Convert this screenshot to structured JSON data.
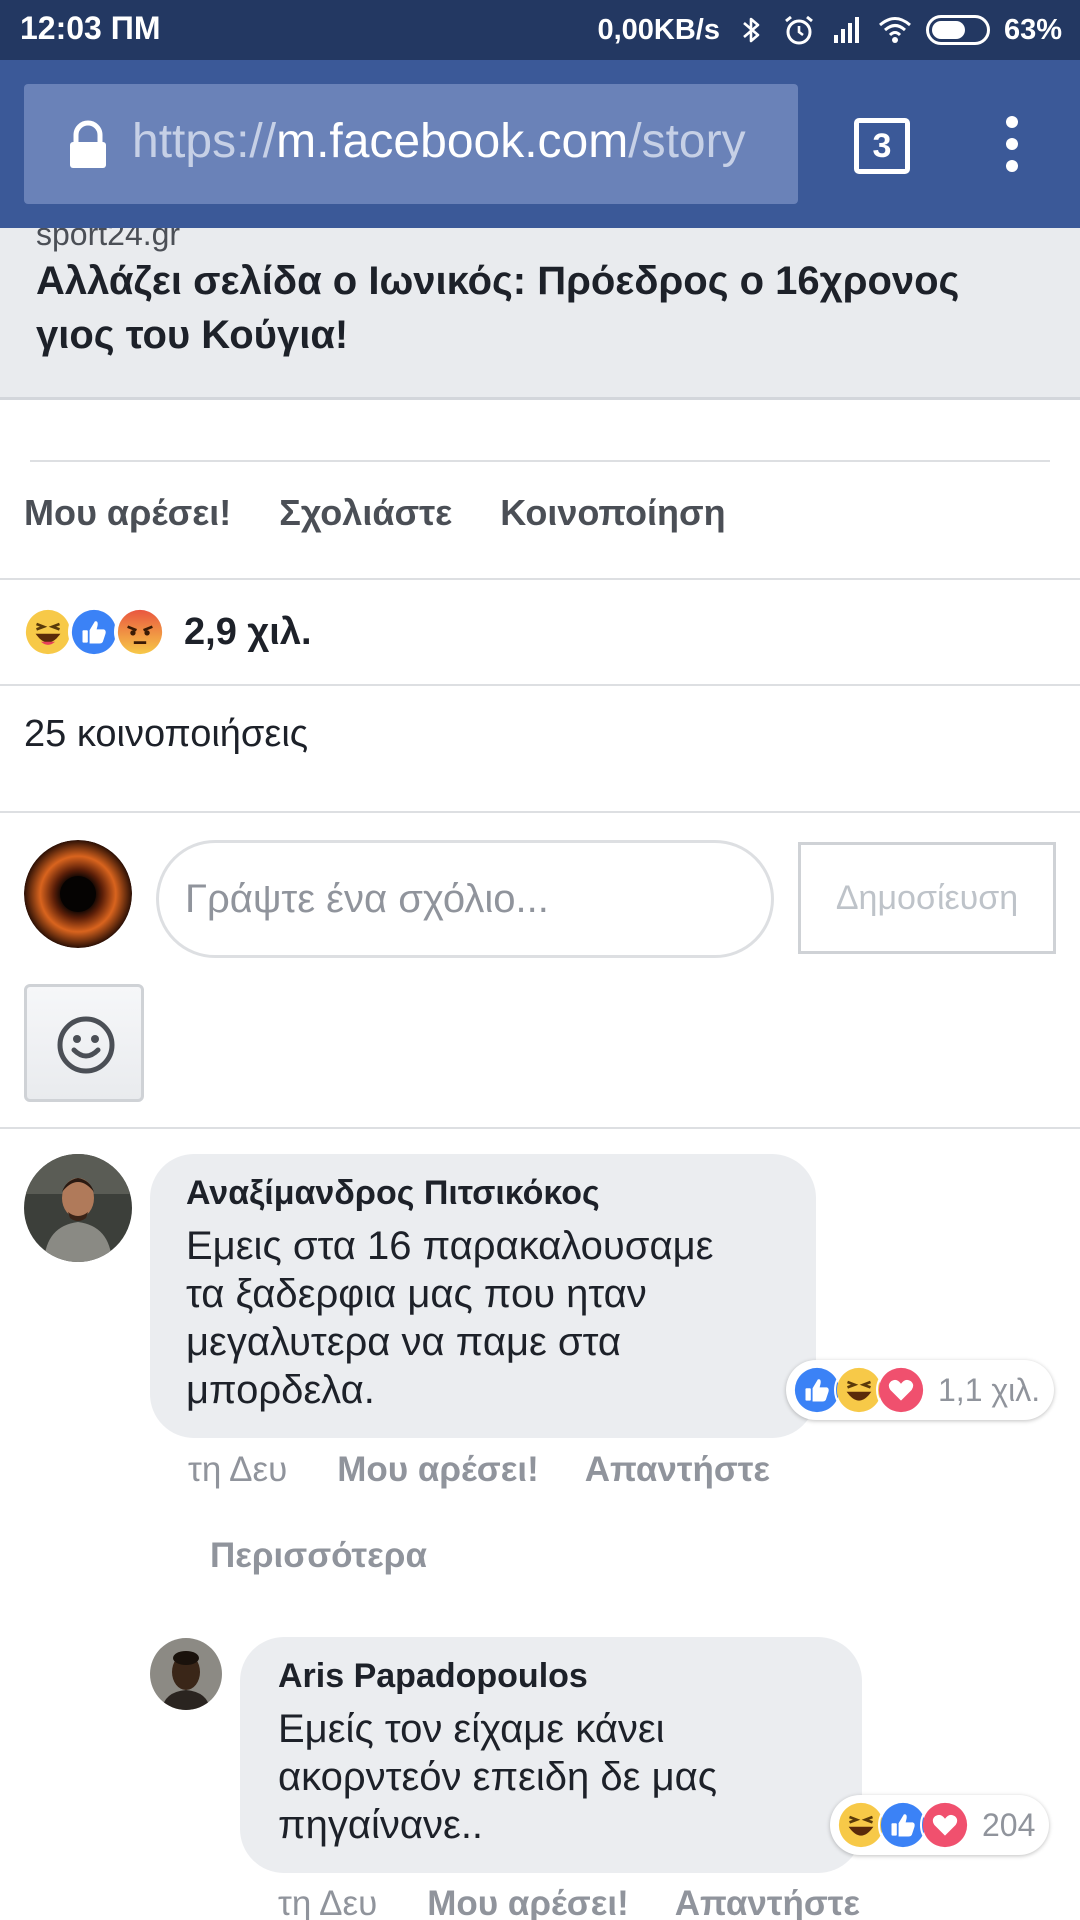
{
  "status_bar": {
    "time": "12:03 ΠΜ",
    "net_speed": "0,00KB/s",
    "battery": "63%",
    "battery_level": 0.63,
    "icons": [
      "bluetooth-icon",
      "alarm-icon",
      "signal-icon",
      "wifi-icon",
      "battery-icon"
    ]
  },
  "browser": {
    "url_scheme": "https://",
    "url_host": "m.facebook.com",
    "url_path": "/story",
    "tab_count": "3"
  },
  "link_preview": {
    "domain": "sport24.gr",
    "headline": "Αλλάζει σελίδα ο Ιωνικός: Πρόεδρος ο 16χρονος γιος του Κούγια!"
  },
  "actions": {
    "like": "Μου αρέσει!",
    "comment": "Σχολιάστε",
    "share": "Κοινοποίηση"
  },
  "reactions": {
    "count": "2,9 χιλ.",
    "types": [
      "haha",
      "like",
      "angry"
    ]
  },
  "shares": "25 κοινοποιήσεις",
  "composer": {
    "placeholder": "Γράψτε ένα σχόλιο...",
    "post_label": "Δημοσίευση"
  },
  "comments": [
    {
      "author": "Αναξίμανδρος Πιτσικόκος",
      "lines": [
        "Εμεις στα 16 παρακαλουσαμε",
        "τα ξαδερφια μας που ηταν",
        "μεγαλυτερα να παμε στα",
        "μπορδελα."
      ],
      "reactions": [
        "like",
        "haha",
        "love"
      ],
      "reaction_count": "1,1 χιλ.",
      "time": "τη Δευ",
      "like_label": "Μου αρέσει!",
      "reply_label": "Απαντήστε",
      "more_label": "Περισσότερα"
    },
    {
      "author": "Aris Papadopoulos",
      "lines": [
        "Εμείς τον είχαμε κάνει",
        "ακορντεόν επειδη δε μας",
        "πηγαίνανε.."
      ],
      "reactions": [
        "haha",
        "like",
        "love"
      ],
      "reaction_count": "204",
      "time": "τη Δευ",
      "like_label": "Μου αρέσει!",
      "reply_label": "Απαντήστε"
    }
  ],
  "colors": {
    "status_bar": "#233862",
    "facebook_blue": "#3b5998",
    "url_box": "#6a82b8",
    "bubble": "#ebedf0",
    "secondary_text": "#90949c"
  }
}
